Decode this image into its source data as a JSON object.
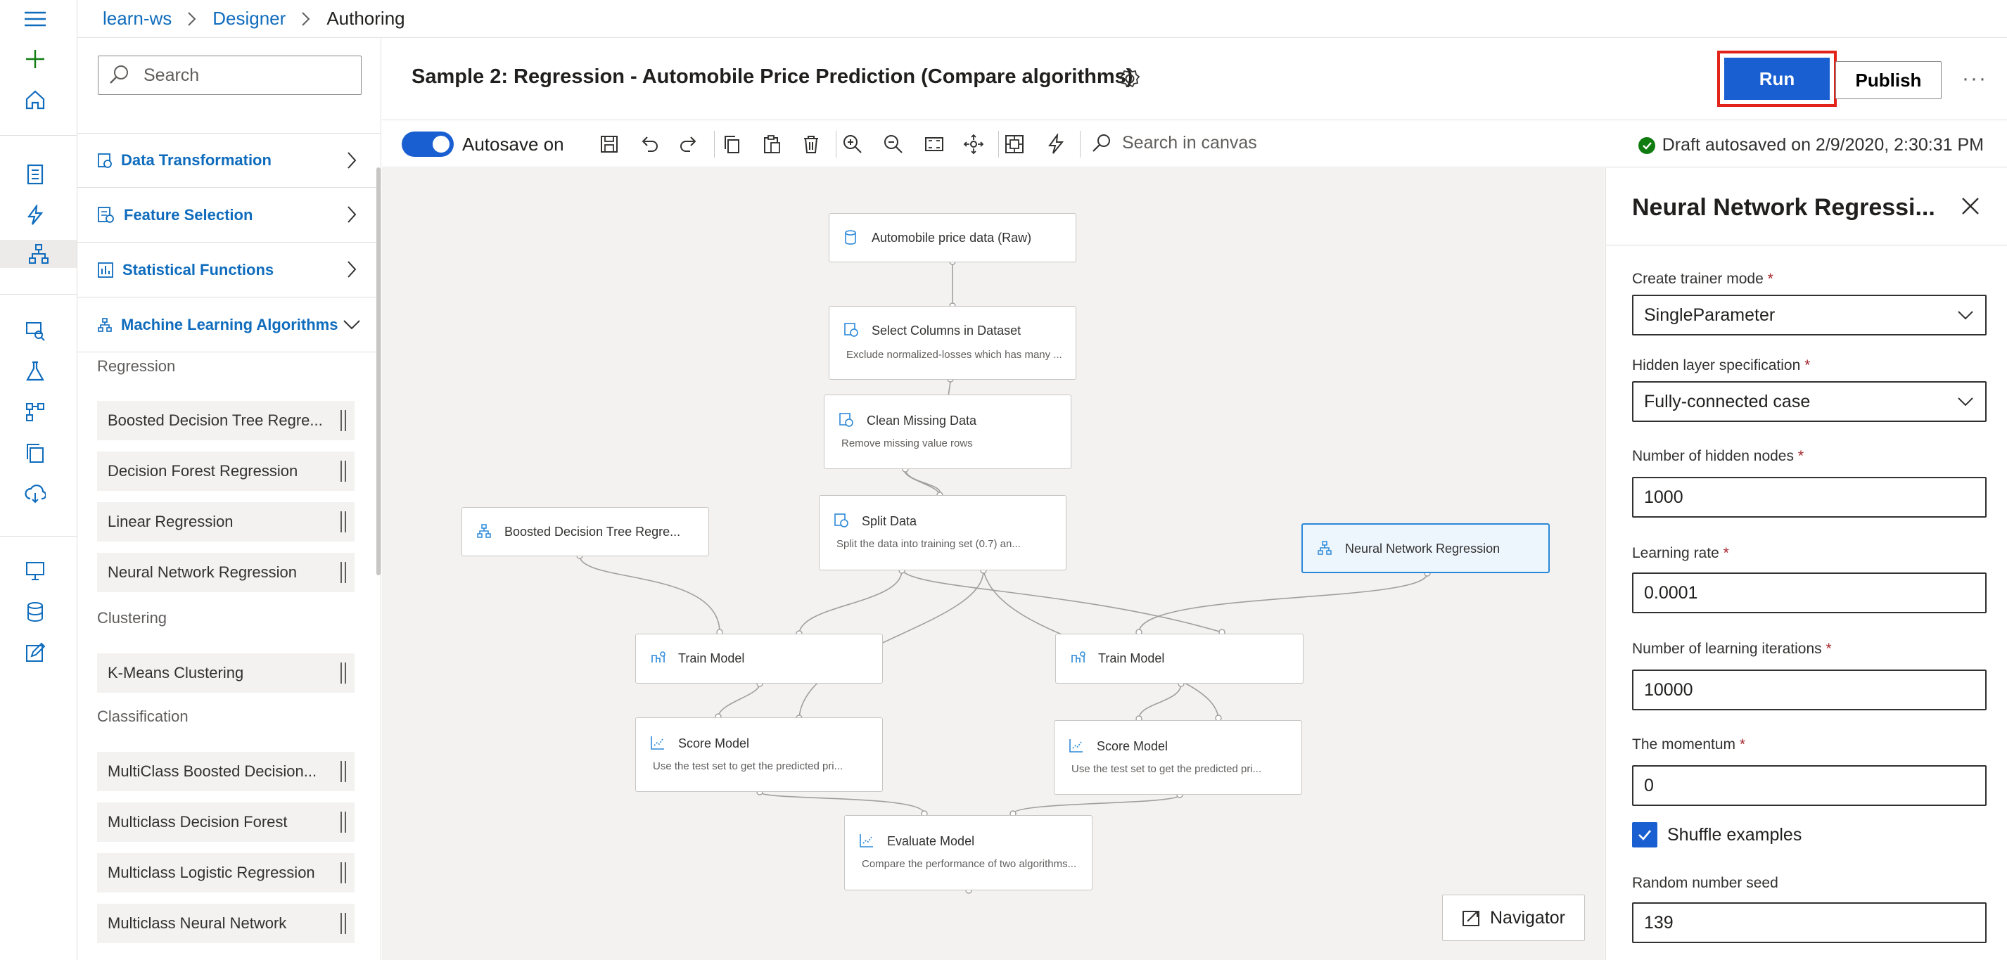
{
  "breadcrumb": {
    "workspace": "learn-ws",
    "designer": "Designer",
    "current": "Authoring"
  },
  "palette": {
    "search_placeholder": "Search",
    "categories": [
      {
        "label": "Data Transformation",
        "icon": "data-transformation-icon"
      },
      {
        "label": "Feature Selection",
        "icon": "feature-selection-icon"
      },
      {
        "label": "Statistical Functions",
        "icon": "statistical-functions-icon"
      },
      {
        "label": "Machine Learning Algorithms",
        "icon": "ml-algorithms-icon"
      }
    ],
    "groups": {
      "regression": {
        "label": "Regression",
        "items": [
          "Boosted Decision Tree Regre...",
          "Decision Forest Regression",
          "Linear Regression",
          "Neural Network Regression"
        ]
      },
      "clustering": {
        "label": "Clustering",
        "items": [
          "K-Means Clustering"
        ]
      },
      "classification": {
        "label": "Classification",
        "items": [
          "MultiClass Boosted Decision...",
          "Multiclass Decision Forest",
          "Multiclass Logistic Regression",
          "Multiclass Neural Network"
        ]
      }
    }
  },
  "header": {
    "title": "Sample 2: Regression - Automobile Price Prediction (Compare algorithms)",
    "run_label": "Run",
    "publish_label": "Publish",
    "more_label": "···"
  },
  "toolbar": {
    "autosave_label": "Autosave on",
    "autosave_on": true,
    "search_placeholder": "Search in canvas",
    "draft_status": "Draft autosaved on 2/9/2020, 2:30:31 PM",
    "status_color": "#107c10"
  },
  "canvas": {
    "nodes": {
      "automobile": {
        "title": "Automobile price data (Raw)",
        "desc": ""
      },
      "select_columns": {
        "title": "Select Columns in Dataset",
        "desc": "Exclude normalized-losses which has many ..."
      },
      "clean_missing": {
        "title": "Clean Missing Data",
        "desc": "Remove missing value rows"
      },
      "split_data": {
        "title": "Split Data",
        "desc": "Split the data into training set (0.7) an..."
      },
      "boosted_tree": {
        "title": "Boosted Decision Tree Regre...",
        "desc": ""
      },
      "neural_network": {
        "title": "Neural Network Regression",
        "desc": ""
      },
      "train_model_1": {
        "title": "Train Model",
        "desc": ""
      },
      "train_model_2": {
        "title": "Train Model",
        "desc": ""
      },
      "score_model_1": {
        "title": "Score Model",
        "desc": "Use the test set to get the predicted pri..."
      },
      "score_model_2": {
        "title": "Score Model",
        "desc": "Use the test set to get the predicted pri..."
      },
      "evaluate_model": {
        "title": "Evaluate Model",
        "desc": "Compare the performance of two algorithms..."
      }
    },
    "navigator_label": "Navigator"
  },
  "properties": {
    "title": "Neural Network Regressi...",
    "fields": {
      "trainer_mode": {
        "label": "Create trainer mode",
        "value": "SingleParameter"
      },
      "hidden_layer": {
        "label": "Hidden layer specification",
        "value": "Fully-connected case"
      },
      "hidden_nodes": {
        "label": "Number of hidden nodes",
        "value": "1000"
      },
      "learning_rate": {
        "label": "Learning rate",
        "value": "0.0001"
      },
      "iterations": {
        "label": "Number of learning iterations",
        "value": "10000"
      },
      "momentum": {
        "label": "The momentum",
        "value": "0"
      },
      "seed": {
        "label": "Random number seed",
        "value": "139"
      }
    },
    "shuffle": {
      "label": "Shuffle examples",
      "checked": true
    },
    "required_marker": "*"
  },
  "colors": {
    "accent": "#1a5fd1",
    "link": "#0f6cbd",
    "highlight_border": "#e2231a",
    "selected_node": "#2b88d8"
  }
}
